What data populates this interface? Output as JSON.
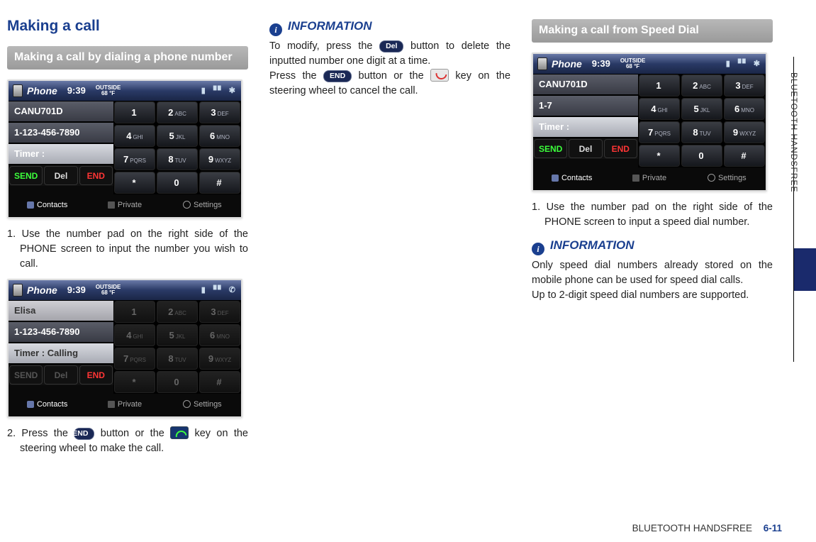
{
  "title": "Making a call",
  "section1_heading": "Making a call by dialing a phone number",
  "section2_heading": "Making a call from Speed Dial",
  "phone_ui": {
    "title": "Phone",
    "time": "9:39",
    "temp_label": "OUTSIDE",
    "temp_value": "68 °F",
    "device_name": "CANU701D",
    "dialed_number": "1-123-456-7890",
    "speed_dial_number": "1-7",
    "contact_name": "Elisa",
    "timer_label": "Timer :",
    "timer_calling": "Timer : Calling",
    "send": "SEND",
    "del": "Del",
    "end": "END",
    "keys": [
      [
        "1",
        "",
        "2",
        "ABC",
        "3",
        "DEF"
      ],
      [
        "4",
        "GHI",
        "5",
        "JKL",
        "6",
        "MNO"
      ],
      [
        "7",
        "PQRS",
        "8",
        "TUV",
        "9",
        "WXYZ"
      ],
      [
        "*",
        "",
        "0",
        "",
        "#",
        ""
      ]
    ],
    "tabs": {
      "contacts": "Contacts",
      "private": "Private",
      "settings": "Settings"
    }
  },
  "col1": {
    "step1": "1. Use the number pad on the right side of the PHONE screen to input the number you wish to call.",
    "step2a": "2. Press the ",
    "step2b": " button or the  ",
    "step2c": " key on the steering wheel to make the call.",
    "send_btn": "SEND"
  },
  "col2": {
    "info_heading": "INFORMATION",
    "line1a": "To modify, press the ",
    "line1b": " button to delete the inputted number one digit at a time.",
    "line2a": "Press the ",
    "line2b": " button or the ",
    "line2c": " key on the steering wheel to cancel the call.",
    "del_btn": "Del",
    "end_btn": "END"
  },
  "col3": {
    "step1": "1. Use the number pad on the right side of the PHONE screen to input a speed dial num­ber.",
    "info_heading": "INFORMATION",
    "info_text1": "Only speed dial numbers already stored on the mobile phone can be used for speed dial calls.",
    "info_text2": "Up to 2-digit speed dial numbers are suppor­ted."
  },
  "side_label": "BLUETOOTH HANDSFREE",
  "footer_label": "BLUETOOTH HANDSFREE",
  "footer_page": "6-11"
}
